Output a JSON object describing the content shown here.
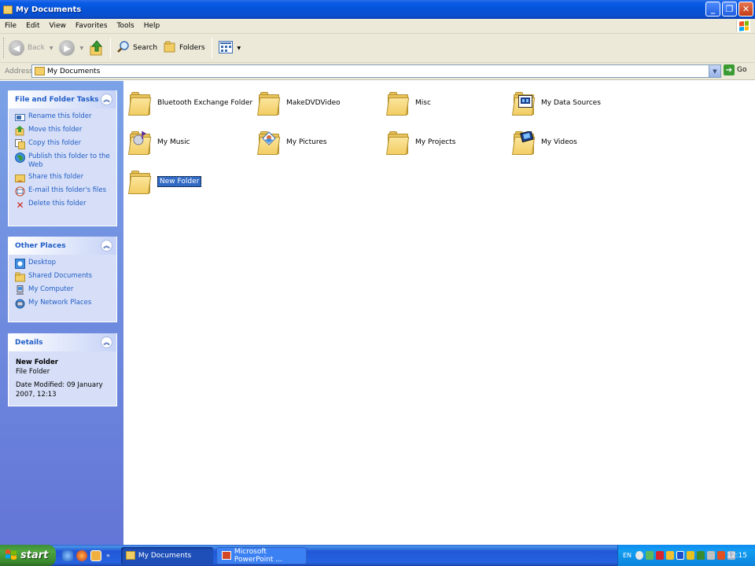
{
  "window": {
    "title": "My Documents",
    "minimize_glyph": "_",
    "maximize_glyph": "❐",
    "close_glyph": "✕"
  },
  "menu": [
    "File",
    "Edit",
    "View",
    "Favorites",
    "Tools",
    "Help"
  ],
  "toolbar": {
    "back": "Back",
    "search": "Search",
    "folders": "Folders"
  },
  "address": {
    "label": "Address",
    "value": "My Documents",
    "go": "Go"
  },
  "file_tasks": {
    "title": "File and Folder Tasks",
    "items": [
      {
        "label": "Rename this folder",
        "icon": "rename-icon"
      },
      {
        "label": "Move this folder",
        "icon": "move-icon"
      },
      {
        "label": "Copy this folder",
        "icon": "copy-icon"
      },
      {
        "label": "Publish this folder to the Web",
        "icon": "publish-web-icon"
      },
      {
        "label": "Share this folder",
        "icon": "share-icon"
      },
      {
        "label": "E-mail this folder's files",
        "icon": "email-icon"
      },
      {
        "label": "Delete this folder",
        "icon": "delete-icon"
      }
    ]
  },
  "other_places": {
    "title": "Other Places",
    "items": [
      {
        "label": "Desktop",
        "icon": "desktop-icon"
      },
      {
        "label": "Shared Documents",
        "icon": "shared-folder-icon"
      },
      {
        "label": "My Computer",
        "icon": "computer-icon"
      },
      {
        "label": "My Network Places",
        "icon": "network-icon"
      }
    ]
  },
  "details": {
    "title": "Details",
    "name": "New Folder",
    "type": "File Folder",
    "modified": "Date Modified: 09 January 2007, 12:13"
  },
  "folders": [
    {
      "label": "Bluetooth Exchange Folder",
      "icon": "folder-icon"
    },
    {
      "label": "MakeDVDVideo",
      "icon": "folder-icon"
    },
    {
      "label": "Misc",
      "icon": "folder-icon"
    },
    {
      "label": "My Data Sources",
      "icon": "data-sources-folder-icon"
    },
    {
      "label": "My Music",
      "icon": "music-folder-icon"
    },
    {
      "label": "My Pictures",
      "icon": "pictures-folder-icon"
    },
    {
      "label": "My Projects",
      "icon": "folder-icon"
    },
    {
      "label": "My Videos",
      "icon": "videos-folder-icon"
    },
    {
      "label": "New Folder",
      "icon": "folder-icon",
      "selected": true
    }
  ],
  "taskbar": {
    "start": "Start",
    "start_label": "start",
    "tasks": [
      {
        "label": "My Documents",
        "active": true
      },
      {
        "label": "Microsoft PowerPoint ...",
        "active": false
      }
    ],
    "language": "EN",
    "clock": "12:15"
  },
  "colors": {
    "titlebar": "#0553d8",
    "task_link": "#215dc6",
    "selection": "#316ac5",
    "start_green": "#3c8f3a"
  }
}
